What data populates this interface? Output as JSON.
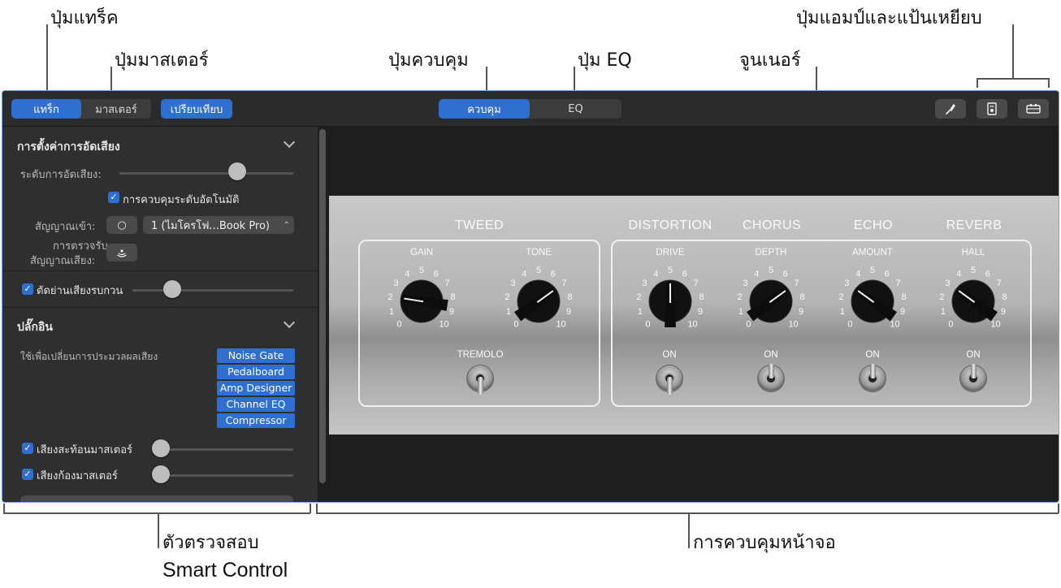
{
  "callouts": {
    "track_button": "ปุ่มแทร็ค",
    "master_button": "ปุ่มมาสเตอร์",
    "controls_button": "ปุ่มควบคุม",
    "eq_button": "ปุ่ม EQ",
    "tuner": "จูนเนอร์",
    "amp_pedal_buttons": "ปุ่มแอมป์และแป้นเหยียบ",
    "inspector_line1": "ตัวตรวจสอบ",
    "inspector_line2": "Smart Control",
    "screen_controls": "การควบคุมหน้าจอ"
  },
  "toolbar": {
    "track_label": "แทร็ก",
    "master_label": "มาสเตอร์",
    "compare_label": "เปรียบเทียบ",
    "controls_label": "ควบคุม",
    "eq_label": "EQ",
    "tuner_icon": "tuning-fork-icon",
    "amp_icon": "amp-icon",
    "pedal_icon": "pedalboard-icon"
  },
  "inspector": {
    "recording_settings_title": "การตั้งค่าการอัดเสียง",
    "recording_level_label": "ระดับการอัดเสียง:",
    "recording_level": 0.73,
    "auto_level_label": "การควบคุมระดับอัตโนมัติ",
    "input_label": "สัญญาณเข้า:",
    "input_mono_symbol": "○",
    "input_value": "1 (ไมโครโฟ...Book Pro)",
    "monitor_label_1": "การตรวจรับ",
    "monitor_label_2": "สัญญาณเสียง:",
    "noise_gate_label": "ตัดย่านเสียงรบกวน",
    "noise_gate_level": 0.25,
    "plugins_title": "ปลั๊กอิน",
    "plugins_desc": "ใช้เพื่อเปลี่ยนการประมวลผลเสียง",
    "plugins": [
      "Noise Gate",
      "Pedalboard",
      "Amp Designer",
      "Channel EQ",
      "Compressor"
    ],
    "master_echo_label": "เสียงสะท้อนมาสเตอร์",
    "master_echo_level": 0.0,
    "master_reverb_label": "เสียงก้องมาสเตอร์",
    "master_reverb_level": 0.0
  },
  "amp": {
    "tweed": "TWEED",
    "distortion": "DISTORTION",
    "chorus": "CHORUS",
    "echo": "ECHO",
    "reverb": "REVERB",
    "gain": "GAIN",
    "tone": "TONE",
    "drive": "DRIVE",
    "depth": "DEPTH",
    "amount": "AMOUNT",
    "hall": "HALL",
    "tremolo": "TREMOLO",
    "on": "ON",
    "knob_values": {
      "gain": 2,
      "tone": 7,
      "drive": 5,
      "depth": 7,
      "amount": 3,
      "hall": 3
    },
    "switches": {
      "tremolo": "down",
      "distortion": "down",
      "chorus": "up",
      "echo": "up",
      "reverb": "up"
    }
  }
}
